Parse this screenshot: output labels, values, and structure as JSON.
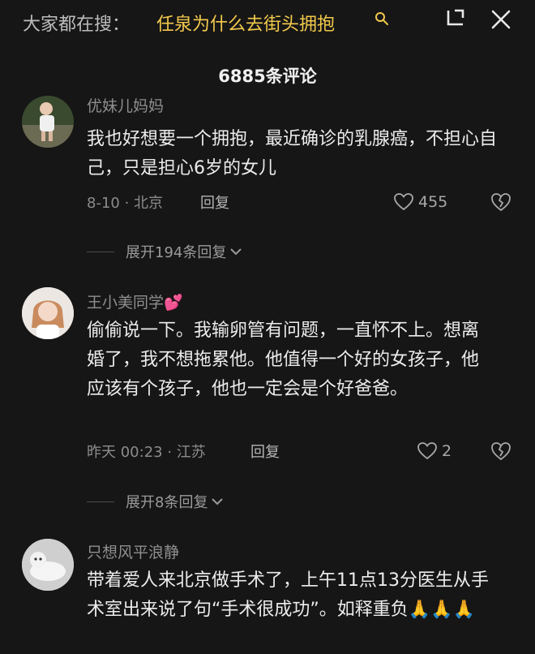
{
  "header": {
    "hot_prefix": "大家都在搜：",
    "hot_query": "任泉为什么去街头拥抱",
    "comment_count_title": "6885条评论"
  },
  "comments": [
    {
      "username": "优妹儿妈妈",
      "text": "我也好想要一个拥抱，最近确诊的乳腺癌，不担心自己，只是担心6岁的女儿",
      "meta": "8-10 · 北京",
      "reply_label": "回复",
      "likes": "455",
      "expand_label": "展开194条回复"
    },
    {
      "username": "王小美同学💕",
      "text": "偷偷说一下。我输卵管有问题，一直怀不上。想离婚了，我不想拖累他。他值得一个好的女孩子，他应该有个孩子，他也一定会是个好爸爸。",
      "meta": "昨天 00:23 · 江苏",
      "reply_label": "回复",
      "likes": "2",
      "expand_label": "展开8条回复"
    },
    {
      "username": "只想风平浪静",
      "text": "带着爱人来北京做手术了，上午11点13分医生从手术室出来说了句“手术很成功”。如释重负🙏🙏🙏"
    }
  ],
  "icons": {
    "search": "search-icon",
    "collapse": "collapse-icon",
    "close": "close-icon",
    "like": "heart-icon",
    "dislike": "broken-heart-icon",
    "expand": "chevron-down-icon"
  },
  "colors": {
    "background": "#161616",
    "hot_query": "#f2c94c",
    "text": "#ececec",
    "secondary": "#8c8c8c"
  }
}
